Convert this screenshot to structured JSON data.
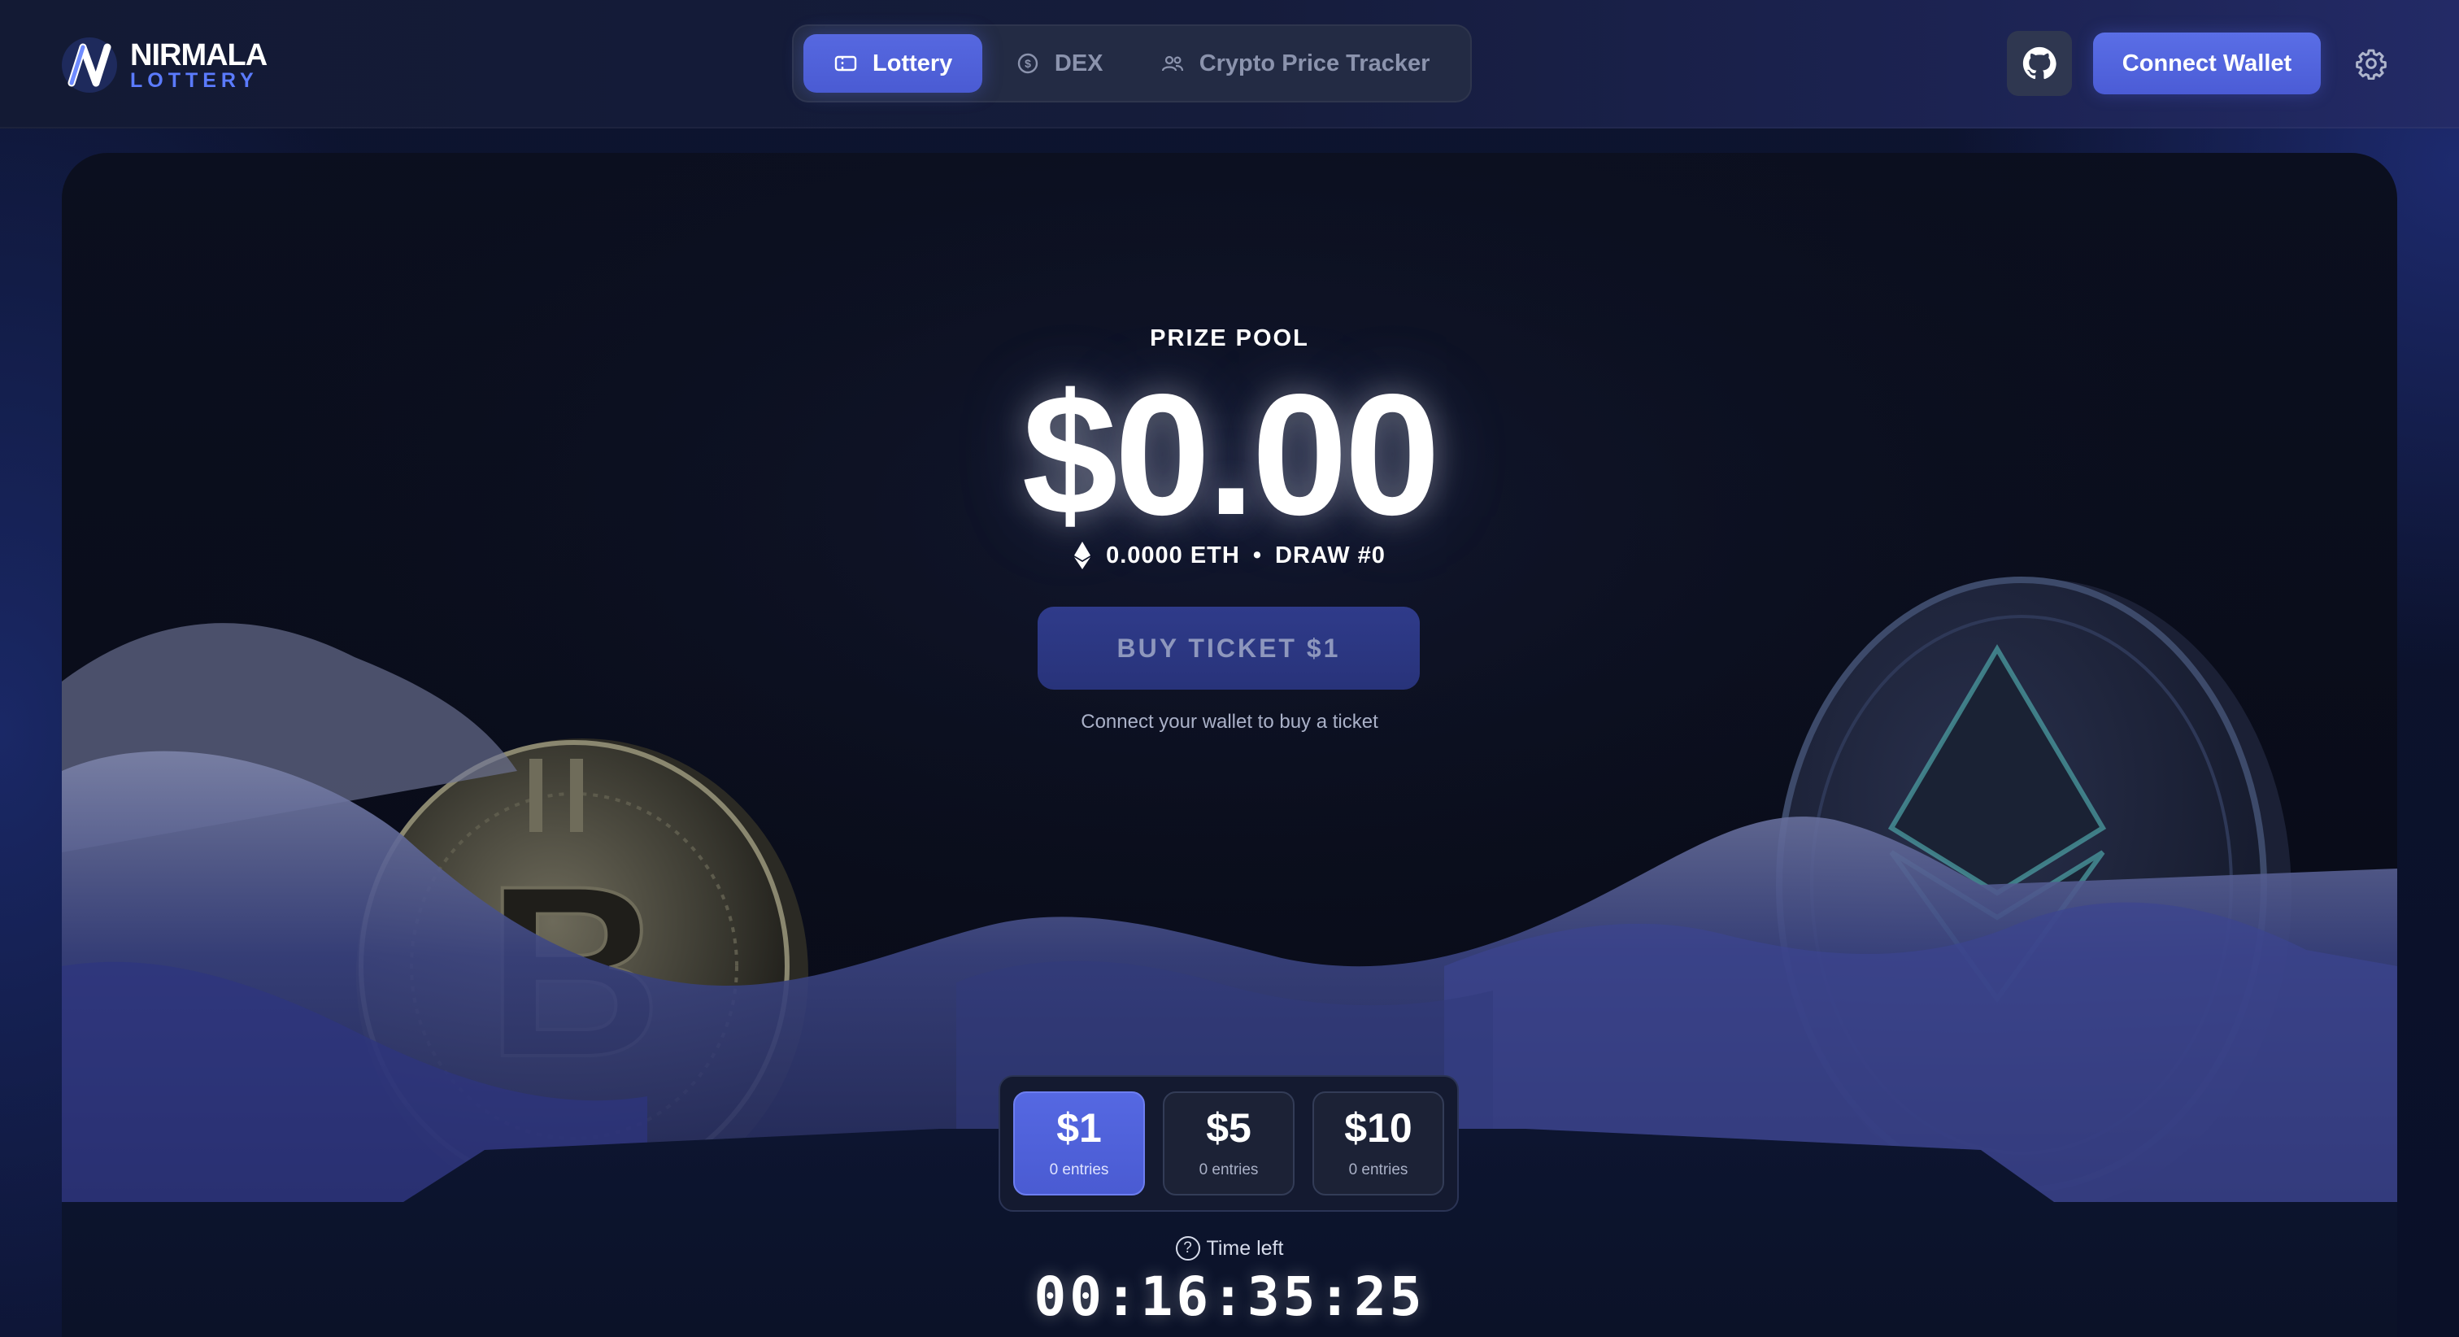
{
  "header": {
    "logo_title": "NIRMALA",
    "logo_subtitle": "LOTTERY",
    "nav": [
      {
        "label": "Lottery",
        "icon": "ticket-icon",
        "active": true
      },
      {
        "label": "DEX",
        "icon": "dollar-coin-icon",
        "active": false
      },
      {
        "label": "Crypto Price Tracker",
        "icon": "users-icon",
        "active": false
      }
    ],
    "github_icon": "github-icon",
    "connect_label": "Connect Wallet",
    "settings_icon": "gear-icon"
  },
  "prize": {
    "label": "PRIZE POOL",
    "amount": "$0.00",
    "eth": "0.0000 ETH",
    "separator": "•",
    "draw": "DRAW #0"
  },
  "buy": {
    "label": "BUY TICKET $1",
    "hint": "Connect your wallet to buy a ticket"
  },
  "tiers": [
    {
      "price": "$1",
      "entries": "0 entries",
      "active": true
    },
    {
      "price": "$5",
      "entries": "0 entries",
      "active": false
    },
    {
      "price": "$10",
      "entries": "0 entries",
      "active": false
    }
  ],
  "timer": {
    "label": "Time left",
    "help_glyph": "?",
    "value": "00:16:35:25"
  },
  "colors": {
    "accent": "#5668e0",
    "logo_accent": "#5b7bff",
    "background": "#0a0f22"
  }
}
